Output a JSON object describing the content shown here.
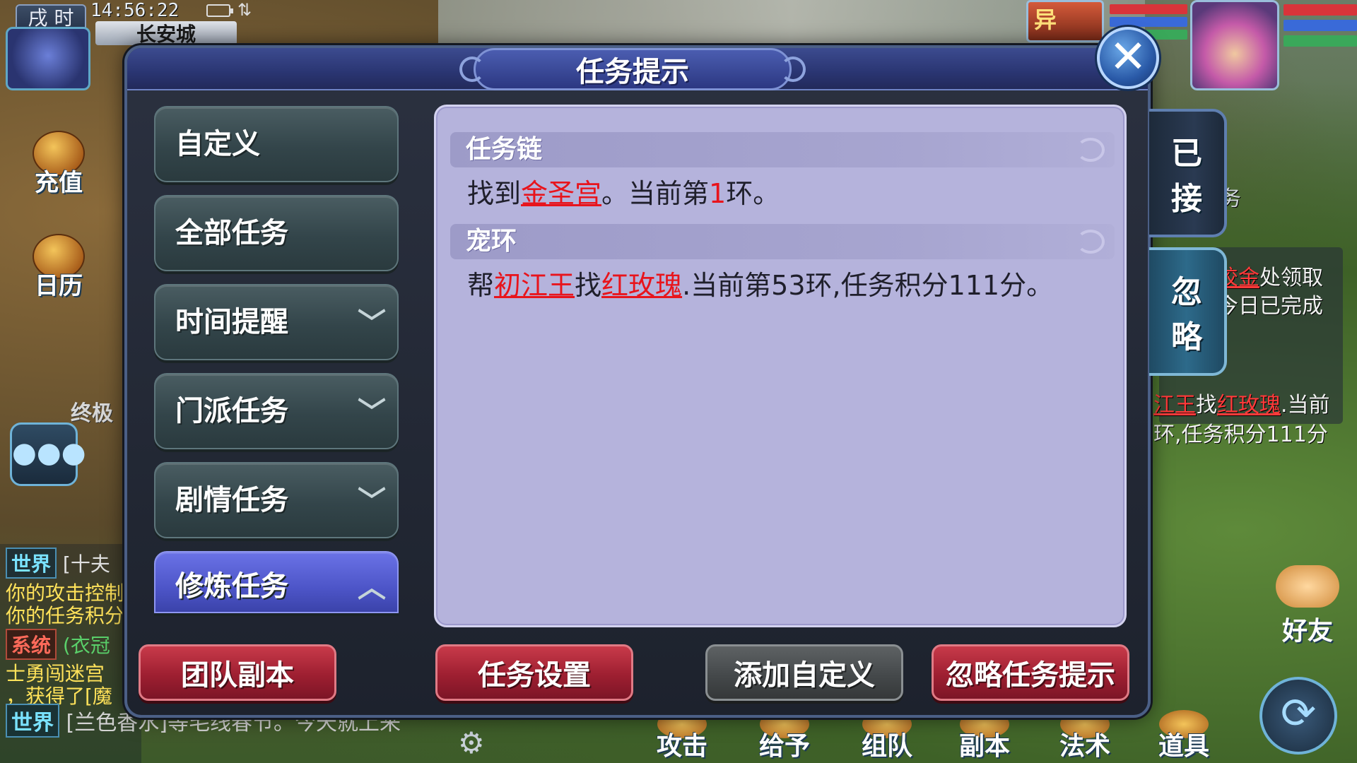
{
  "hud": {
    "period": "戌 时",
    "clock": "14:56:22",
    "city": "长安城",
    "side_icons": [
      {
        "label": "充值",
        "icon": "treasure-chest-icon"
      },
      {
        "label": "日历",
        "icon": "calendar-icon"
      }
    ],
    "faded_label": "终极",
    "pet_label": "异",
    "friend_label": "好友",
    "bottom_menu": [
      "攻击",
      "给予",
      "组队",
      "副本",
      "法术",
      "道具"
    ]
  },
  "chat": {
    "lines": [
      {
        "tag": "世界",
        "text": "[十夫"
      },
      {
        "tag": "",
        "text": "你的攻击控制"
      },
      {
        "tag": "",
        "text": "你的任务积分"
      },
      {
        "tag": "系统",
        "text": "(衣冠"
      },
      {
        "tag": "",
        "text": "士勇闯迷宫"
      },
      {
        "tag": "",
        "text": "，获得了[魔"
      }
    ],
    "bottom": {
      "tag": "世界",
      "text": "[兰色香水]等毛线春节。今天就上来"
    }
  },
  "tracker": {
    "line1_red": "皎金",
    "line1_rest": "处领取",
    "line2": "今日已完成",
    "line3_red_a": "江王",
    "line3_mid": "找",
    "line3_red_b": "红玫瑰",
    "line3_rest": ".当前",
    "line4": "环,任务积分111分",
    "frag": "务"
  },
  "dialog": {
    "title": "任务提示",
    "close_label": "✕",
    "categories": [
      {
        "label": "自定义",
        "chevron": ""
      },
      {
        "label": "全部任务",
        "chevron": ""
      },
      {
        "label": "时间提醒",
        "chevron": "﹀"
      },
      {
        "label": "门派任务",
        "chevron": "﹀"
      },
      {
        "label": "剧情任务",
        "chevron": "﹀"
      },
      {
        "label": "修炼任务",
        "chevron": "︿"
      }
    ],
    "tasks": [
      {
        "name": "任务链",
        "p1": "找到",
        "link1": "金圣宫",
        "p2": "。当前第",
        "num": "1",
        "p3": "环。"
      },
      {
        "name": "宠环",
        "p1": "帮",
        "link1": "初江王",
        "p2": "找",
        "link2": "红玫瑰",
        "p3": ".当前第53环,任务积分111分。"
      }
    ],
    "side_tabs": [
      {
        "label_top": "已",
        "label_bottom": "接"
      },
      {
        "label_top": "忽",
        "label_bottom": "略"
      }
    ],
    "buttons": {
      "team_dungeon": "团队副本",
      "task_settings": "任务设置",
      "add_custom": "添加自定义",
      "ignore_hints": "忽略任务提示"
    }
  },
  "colors": {
    "dialog_bg": "#1d222d",
    "content_bg": "#b5b3dc",
    "link_red": "#e8141c",
    "active_category": "#5b63d6",
    "button_red": "#9e1f31",
    "button_gray": "#45494b"
  }
}
